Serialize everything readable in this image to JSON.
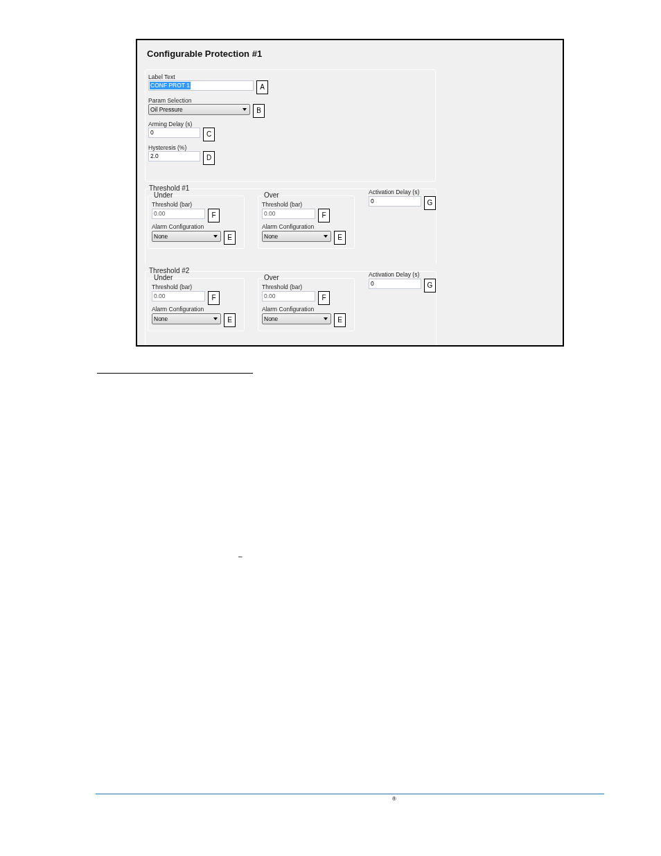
{
  "screenshot": {
    "title": "Configurable Protection #1",
    "general_fields": [
      {
        "kind": "text",
        "label": "Label Text",
        "value": "CONF PROT 1",
        "text_selected": true,
        "tag": "A"
      },
      {
        "kind": "dropdown",
        "label": "Param Selection",
        "value": "Oil Pressure",
        "text_selected": false,
        "tag": "B"
      },
      {
        "kind": "number",
        "label": "Arming Delay (s)",
        "value": "0",
        "text_selected": false,
        "tag": "C"
      },
      {
        "kind": "number",
        "label": "Hysteresis (%)",
        "value": "2.0",
        "text_selected": false,
        "tag": "D"
      }
    ],
    "thresholds": [
      {
        "title": "Threshold #1",
        "sides": [
          {
            "title": "Under",
            "threshold_label": "Threshold (bar)",
            "threshold_value": "0.00",
            "threshold_tag": "F",
            "alarm_label": "Alarm Configuration",
            "alarm_value": "None",
            "alarm_tag": "E"
          },
          {
            "title": "Over",
            "threshold_label": "Threshold (bar)",
            "threshold_value": "0.00",
            "threshold_tag": "F",
            "alarm_label": "Alarm Configuration",
            "alarm_value": "None",
            "alarm_tag": "E"
          }
        ],
        "activation_delay": {
          "label": "Activation Delay (s)",
          "value": "0",
          "tag": "G"
        }
      },
      {
        "title": "Threshold #2",
        "sides": [
          {
            "title": "Under",
            "threshold_label": "Threshold (bar)",
            "threshold_value": "0.00",
            "threshold_tag": "F",
            "alarm_label": "Alarm Configuration",
            "alarm_value": "None",
            "alarm_tag": "E"
          },
          {
            "title": "Over",
            "threshold_label": "Threshold (bar)",
            "threshold_value": "0.00",
            "threshold_tag": "F",
            "alarm_label": "Alarm Configuration",
            "alarm_value": "None",
            "alarm_tag": "E"
          }
        ],
        "activation_delay": {
          "label": "Activation Delay (s)",
          "value": "0",
          "tag": "G"
        }
      }
    ]
  },
  "page": {
    "dash": "–",
    "footer_mark": "®"
  }
}
